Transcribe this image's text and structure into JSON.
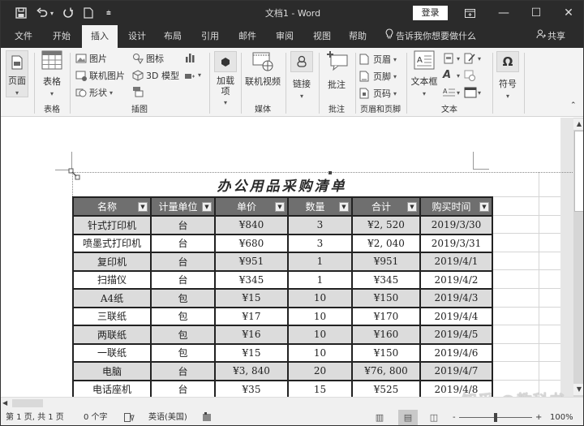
{
  "titlebar": {
    "doc_title": "文档1 - Word",
    "login_label": "登录",
    "quick_access": [
      "save-icon",
      "undo-icon",
      "redo-icon",
      "new-doc-icon",
      "customize-icon"
    ],
    "window_buttons": [
      "ribbon-display-options",
      "minimize",
      "maximize",
      "close"
    ]
  },
  "tabs": [
    {
      "label": "文件"
    },
    {
      "label": "开始"
    },
    {
      "label": "插入",
      "active": true
    },
    {
      "label": "设计"
    },
    {
      "label": "布局"
    },
    {
      "label": "引用"
    },
    {
      "label": "邮件"
    },
    {
      "label": "审阅"
    },
    {
      "label": "视图"
    },
    {
      "label": "帮助"
    }
  ],
  "tell_me": "告诉我你想要做什么",
  "share_label": "共享",
  "ribbon": {
    "pages": {
      "label": "页面"
    },
    "tables": {
      "button": "表格",
      "group": "表格"
    },
    "illustrations": {
      "group": "插图",
      "pictures": "图片",
      "online_pictures": "联机图片",
      "shapes": "形状",
      "icons": "图标",
      "models_3d": "3D 模型"
    },
    "addins": {
      "label": "加载项"
    },
    "media": {
      "online_video": "联机视频",
      "group": "媒体"
    },
    "links": {
      "label": "链接"
    },
    "comments": {
      "button": "批注",
      "group": "批注"
    },
    "header_footer": {
      "header": "页眉",
      "footer": "页脚",
      "page_number": "页码",
      "group": "页眉和页脚"
    },
    "text": {
      "textbox": "文本框",
      "group": "文本"
    },
    "symbols": {
      "label": "符号"
    }
  },
  "sheet": {
    "title": "办公用品采购清单",
    "headers": [
      "名称",
      "计量单位",
      "单价",
      "数量",
      "合计",
      "购买时间"
    ],
    "rows": [
      [
        "针式打印机",
        "台",
        "¥840",
        "3",
        "¥2, 520",
        "2019/3/30"
      ],
      [
        "喷墨式打印机",
        "台",
        "¥680",
        "3",
        "¥2, 040",
        "2019/3/31"
      ],
      [
        "复印机",
        "台",
        "¥951",
        "1",
        "¥951",
        "2019/4/1"
      ],
      [
        "扫描仪",
        "台",
        "¥345",
        "1",
        "¥345",
        "2019/4/2"
      ],
      [
        "A4纸",
        "包",
        "¥15",
        "10",
        "¥150",
        "2019/4/3"
      ],
      [
        "三联纸",
        "包",
        "¥17",
        "10",
        "¥170",
        "2019/4/4"
      ],
      [
        "两联纸",
        "包",
        "¥16",
        "10",
        "¥160",
        "2019/4/5"
      ],
      [
        "一联纸",
        "包",
        "¥15",
        "10",
        "¥150",
        "2019/4/6"
      ],
      [
        "电脑",
        "台",
        "¥3, 840",
        "20",
        "¥76, 800",
        "2019/4/7"
      ],
      [
        "电话座机",
        "台",
        "¥35",
        "15",
        "¥525",
        "2019/4/8"
      ]
    ]
  },
  "statusbar": {
    "page_info": "第 1 页, 共 1 页",
    "word_count": "0 个字",
    "language": "英语(美国)",
    "zoom_level": "100%",
    "zoom_minus": "-",
    "zoom_plus": "+"
  },
  "watermark": "知乎 @教科书"
}
